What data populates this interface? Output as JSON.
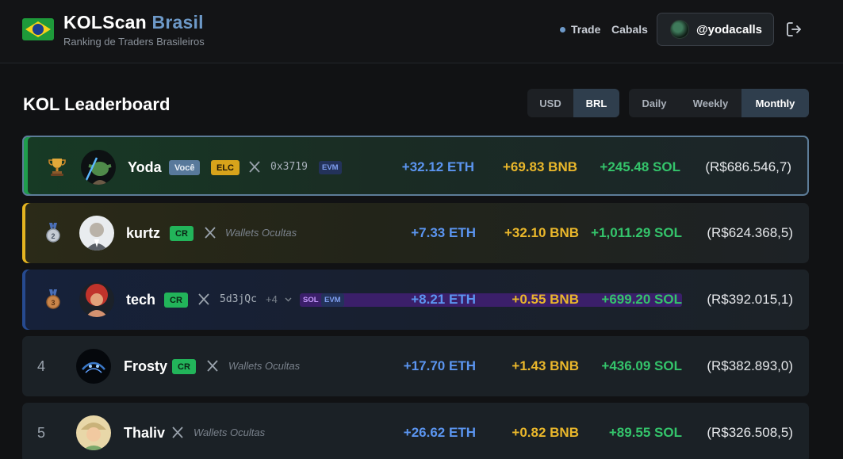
{
  "header": {
    "brand_main": "KOLScan",
    "brand_accent": "Brasil",
    "tagline": "Ranking de Traders Brasileiros",
    "nav": {
      "trade": "Trade",
      "cabals": "Cabals"
    },
    "user_handle": "@yodacalls"
  },
  "page": {
    "title": "KOL Leaderboard",
    "currency_options": [
      "USD",
      "BRL"
    ],
    "currency_selected": "BRL",
    "period_options": [
      "Daily",
      "Weekly",
      "Monthly"
    ],
    "period_selected": "Monthly"
  },
  "rows": [
    {
      "rank": "1",
      "rank_icon": "trophy-icon",
      "name": "Yoda",
      "badges": [
        "Você",
        "ELC"
      ],
      "wallet": "0x3719",
      "chains": [
        "EVM"
      ],
      "eth": "+32.12 ETH",
      "bnb": "+69.83 BNB",
      "sol": "+245.48 SOL",
      "brl": "(R$686.546,7)"
    },
    {
      "rank": "2",
      "rank_icon": "silver-medal-icon",
      "name": "kurtz",
      "badges": [
        "CR"
      ],
      "wallet": "Wallets Ocultas",
      "eth": "+7.33 ETH",
      "bnb": "+32.10 BNB",
      "sol": "+1,011.29 SOL",
      "brl": "(R$624.368,5)"
    },
    {
      "rank": "3",
      "rank_icon": "bronze-medal-icon",
      "name": "tech",
      "badges": [
        "CR"
      ],
      "wallet": "5d3jQc",
      "more": "+4",
      "chains": [
        "SOL",
        "EVM"
      ],
      "eth": "+8.21 ETH",
      "bnb": "+0.55 BNB",
      "sol": "+699.20 SOL",
      "brl": "(R$392.015,1)"
    },
    {
      "rank": "4",
      "name": "Frosty",
      "badges": [
        "CR"
      ],
      "wallet": "Wallets Ocultas",
      "eth": "+17.70 ETH",
      "bnb": "+1.43 BNB",
      "sol": "+436.09 SOL",
      "brl": "(R$382.893,0)"
    },
    {
      "rank": "5",
      "name": "Thaliv",
      "wallet": "Wallets Ocultas",
      "eth": "+26.62 ETH",
      "bnb": "+0.82 BNB",
      "sol": "+89.55 SOL",
      "brl": "(R$326.508,5)"
    }
  ],
  "colors": {
    "eth": "#5b95f0",
    "bnb": "#eab72b",
    "sol": "#34c46b",
    "accent": "#6d99c8"
  }
}
